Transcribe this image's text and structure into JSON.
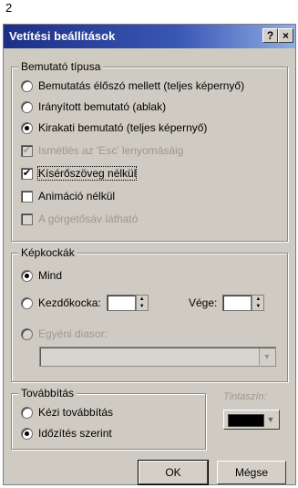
{
  "page_number": "2",
  "dialog": {
    "title": "Vetítési beállítások",
    "help_label": "?",
    "close_label": "×"
  },
  "bemutato": {
    "legend": "Bemutató típusa",
    "options": [
      "Bemutatás élőszó mellett (teljes képernyő)",
      "Irányított bemutató (ablak)",
      "Kirakati bemutató (teljes képernyő)"
    ],
    "selected": 2,
    "checks": [
      {
        "label": "Ismétlés az 'Esc' lenyomásáig",
        "checked": true,
        "disabled": true
      },
      {
        "label": "Kísérőszöveg nélkül",
        "checked": true,
        "disabled": false
      },
      {
        "label": "Animáció nélkül",
        "checked": false,
        "disabled": false
      },
      {
        "label": "A görgetősáv látható",
        "checked": false,
        "disabled": true
      }
    ]
  },
  "kepkockak": {
    "legend": "Képkockák",
    "all_label": "Mind",
    "from_label": "Kezdőkocka:",
    "to_label": "Vége:",
    "custom_label": "Egyéni diasor:",
    "selected": "all"
  },
  "tovabbitas": {
    "legend": "Továbbítás",
    "manual_label": "Kézi továbbítás",
    "timed_label": "Időzítés szerint",
    "selected": "timed"
  },
  "ink": {
    "label": "Tintaszín:",
    "color": "#000000"
  },
  "buttons": {
    "ok": "OK",
    "cancel": "Mégse"
  },
  "colors": {
    "title_start": "#1c2f86",
    "title_end": "#8eaee3",
    "dialog_bg": "#cfcbc2"
  }
}
